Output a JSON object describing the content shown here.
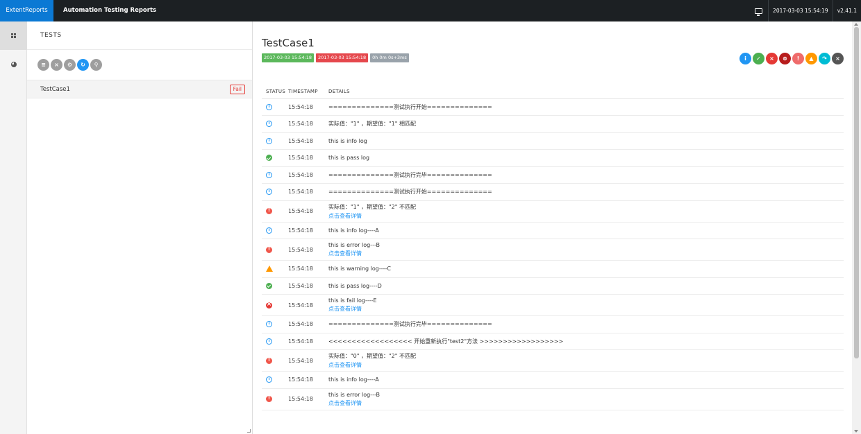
{
  "topbar": {
    "brand": "ExtentReports",
    "title": "Automation Testing Reports",
    "datetime": "2017-03-03 15:54:19",
    "version": "v2.41.1"
  },
  "list": {
    "header": "TESTS",
    "tests": [
      {
        "name": "TestCase1",
        "status": "Fail"
      }
    ]
  },
  "detail": {
    "title": "TestCase1",
    "start_time": "2017-03-03 15:54:18",
    "end_time": "2017-03-03 15:54:18",
    "duration": "0h 0m 0s+3ms",
    "columns": [
      "STATUS",
      "TIMESTAMP",
      "DETAILS"
    ],
    "logs": [
      {
        "status": "info",
        "time": "15:54:18",
        "detail": "==============测试执行开始=============="
      },
      {
        "status": "info",
        "time": "15:54:18",
        "detail": "实际值：\"1\" ，期望值：\"1\" 相匹配"
      },
      {
        "status": "info",
        "time": "15:54:18",
        "detail": "this is info log"
      },
      {
        "status": "pass",
        "time": "15:54:18",
        "detail": "this is pass log"
      },
      {
        "status": "info",
        "time": "15:54:18",
        "detail": "==============测试执行完毕=============="
      },
      {
        "status": "info",
        "time": "15:54:18",
        "detail": "==============测试执行开始=============="
      },
      {
        "status": "error",
        "time": "15:54:18",
        "detail": "实际值：\"1\" ，期望值：\"2\" 不匹配",
        "link": "点击查看详情"
      },
      {
        "status": "info",
        "time": "15:54:18",
        "detail": "this is info log----A"
      },
      {
        "status": "error",
        "time": "15:54:18",
        "detail": "this is error log---B",
        "link": "点击查看详情"
      },
      {
        "status": "warning",
        "time": "15:54:18",
        "detail": "this is warning log----C"
      },
      {
        "status": "pass",
        "time": "15:54:18",
        "detail": "this is pass log----D"
      },
      {
        "status": "fail",
        "time": "15:54:18",
        "detail": "this is fail log----E",
        "link": "点击查看详情"
      },
      {
        "status": "info",
        "time": "15:54:18",
        "detail": "==============测试执行完毕=============="
      },
      {
        "status": "info",
        "time": "15:54:18",
        "detail": "<<<<<<<<<<<<<<<<<< 开始重新执行\"test2\"方法 >>>>>>>>>>>>>>>>>>"
      },
      {
        "status": "error",
        "time": "15:54:18",
        "detail": "实际值：\"0\" ，期望值：\"2\" 不匹配",
        "link": "点击查看详情"
      },
      {
        "status": "info",
        "time": "15:54:18",
        "detail": "this is info log----A"
      },
      {
        "status": "error",
        "time": "15:54:18",
        "detail": "this is error log---B",
        "link": "点击查看详情"
      }
    ]
  },
  "colors": {
    "brand": "#0b79d4",
    "topbar": "#1c2023",
    "pass": "#4caf50",
    "fail": "#e53935",
    "info": "#2196f3",
    "warning": "#ff9800"
  }
}
